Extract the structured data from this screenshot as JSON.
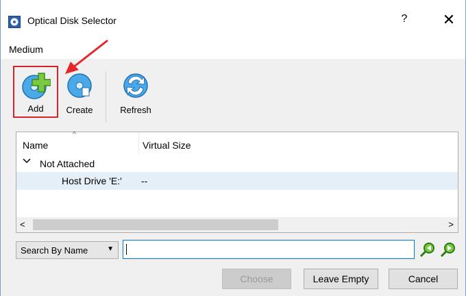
{
  "window": {
    "title": "Optical Disk Selector",
    "help_label": "?",
    "close_label": "✕"
  },
  "menu": {
    "medium": "Medium"
  },
  "toolbar": {
    "add": "Add",
    "create": "Create",
    "refresh": "Refresh"
  },
  "list": {
    "columns": {
      "name": "Name",
      "virtual_size": "Virtual Size",
      "sort_indicator": "^"
    },
    "group": {
      "chevron": "✓",
      "label": "Not Attached"
    },
    "items": [
      {
        "name": "Host Drive 'E:'",
        "size": "--"
      }
    ],
    "scroll_left": "<",
    "scroll_right": ">"
  },
  "search": {
    "mode": "Search By Name",
    "dropdown_glyph": "▼",
    "value": ""
  },
  "buttons": {
    "choose": "Choose",
    "leave_empty": "Leave Empty",
    "cancel": "Cancel"
  },
  "colors": {
    "highlight_box": "#d8232a",
    "arrow": "#e5262b",
    "selection_row": "#e5eff8",
    "focus_border": "#0078d7"
  }
}
